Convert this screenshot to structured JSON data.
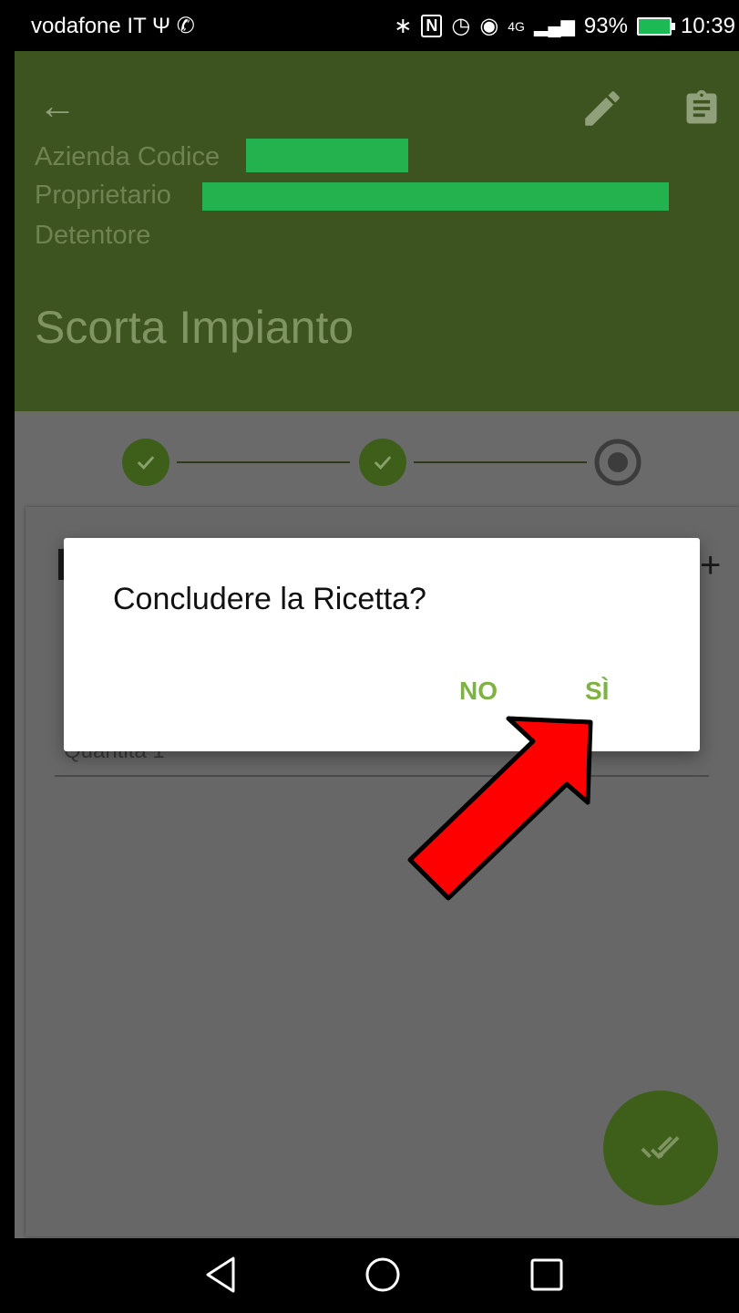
{
  "status_bar": {
    "carrier": "vodafone IT",
    "usb_icon": "usb-icon",
    "whatsapp_icon": "whatsapp-icon",
    "bluetooth_icon": "bluetooth-icon",
    "nfc_icon": "nfc-icon",
    "alarm_icon": "alarm-icon",
    "eye_icon": "eye-icon",
    "signal": "4G",
    "battery": "93%",
    "time": "10:39"
  },
  "header": {
    "azienda_label": "Azienda Codice",
    "proprietario_label": "Proprietario",
    "detentore_label": "Detentore",
    "title": "Scorta Impianto",
    "color": "#3e5420",
    "redaction_color": "#24b24e"
  },
  "stepper": {
    "steps": [
      "completed",
      "completed",
      "active"
    ]
  },
  "card": {
    "quantity_label": "Quantità",
    "quantity_value": "1"
  },
  "dialog": {
    "message": "Concludere la Ricetta?",
    "no_label": "NO",
    "yes_label": "SÌ",
    "button_color": "#7cb342"
  },
  "fab": {
    "icon": "done-all-icon"
  },
  "nav_bar": {
    "back": "triangle-back-icon",
    "home": "circle-home-icon",
    "recents": "square-recents-icon"
  },
  "annotation": {
    "arrow_color": "#ff0000"
  }
}
